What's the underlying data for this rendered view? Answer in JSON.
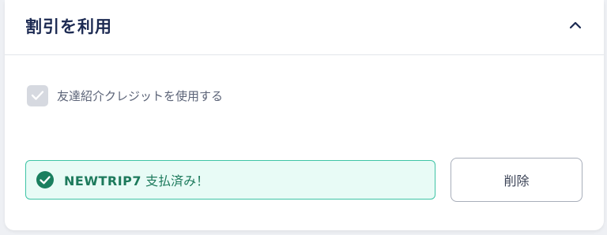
{
  "header": {
    "title": "割引を利用",
    "collapse_icon": "chevron-up-icon"
  },
  "referral": {
    "checked": true,
    "disabled": true,
    "label": "友達紹介クレジットを使用する"
  },
  "promo": {
    "code": "NEWTRIP7",
    "status": "支払済み！",
    "status_icon": "check-circle-icon",
    "remove_label": "削除"
  },
  "colors": {
    "title": "#1c2a52",
    "success_fill": "#e8fbf6",
    "success_border": "#3fc4a6",
    "success_icon": "#1a7f5f",
    "success_text": "#1d7a5c",
    "checkbox_disabled": "#d6d9e0"
  }
}
